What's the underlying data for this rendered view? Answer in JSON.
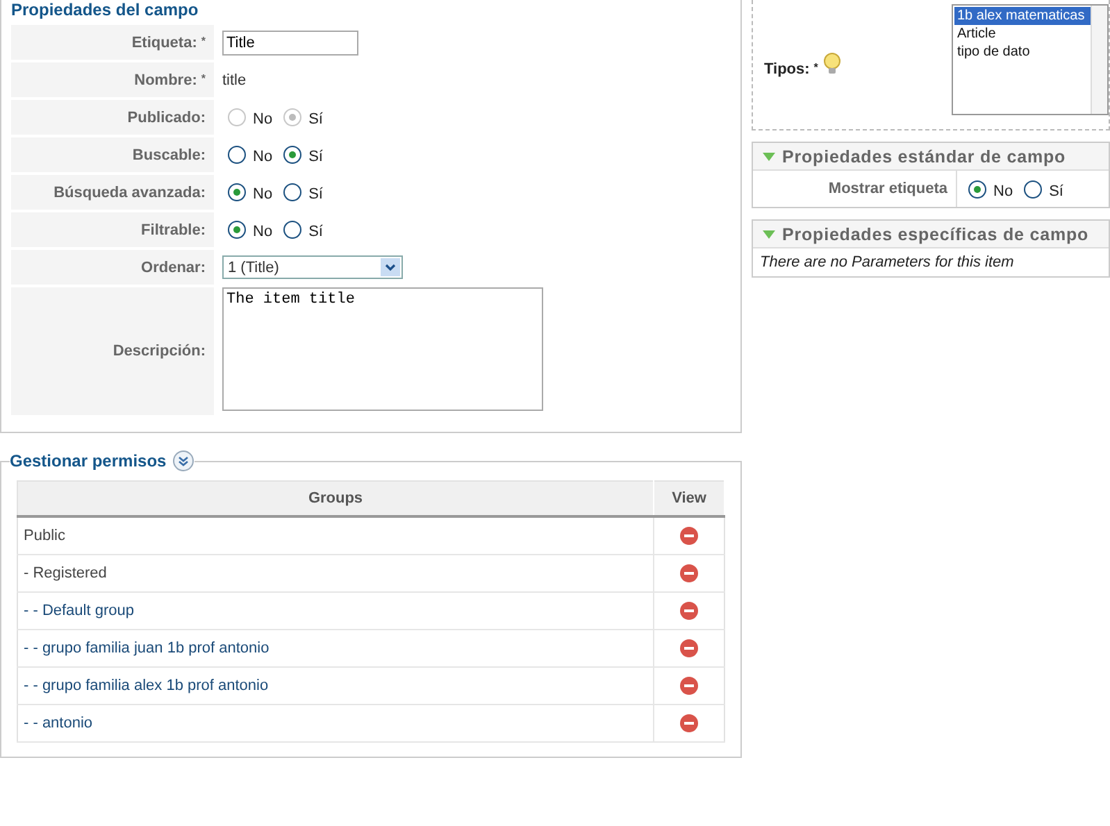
{
  "field_panel": {
    "title": "Propiedades del campo",
    "fields": [
      {
        "kind": "text-input",
        "label": "Etiqueta:",
        "required_mark": "*",
        "value": "Title"
      },
      {
        "kind": "text",
        "label": "Nombre:",
        "required_mark": "*",
        "value": "title"
      },
      {
        "kind": "radio",
        "label": "Publicado:",
        "disabled": true,
        "options": [
          {
            "label": "No",
            "selected": false
          },
          {
            "label": "Sí",
            "selected": true
          }
        ]
      },
      {
        "kind": "radio",
        "label": "Buscable:",
        "disabled": false,
        "options": [
          {
            "label": "No",
            "selected": false
          },
          {
            "label": "Sí",
            "selected": true
          }
        ]
      },
      {
        "kind": "radio",
        "label": "Búsqueda avanzada:",
        "disabled": false,
        "options": [
          {
            "label": "No",
            "selected": true
          },
          {
            "label": "Sí",
            "selected": false
          }
        ]
      },
      {
        "kind": "radio",
        "label": "Filtrable:",
        "disabled": false,
        "options": [
          {
            "label": "No",
            "selected": true
          },
          {
            "label": "Sí",
            "selected": false
          }
        ]
      },
      {
        "kind": "select",
        "label": "Ordenar:",
        "value": "1 (Title)"
      },
      {
        "kind": "textarea",
        "label": "Descripción:",
        "value": "The item title"
      }
    ]
  },
  "permissions": {
    "title": "Gestionar permisos",
    "columns": [
      "Groups",
      "View"
    ],
    "rows": [
      {
        "kind": "plain",
        "group": "Public"
      },
      {
        "kind": "plain",
        "group": "- Registered"
      },
      {
        "kind": "link",
        "group": "- - Default group"
      },
      {
        "kind": "link",
        "group": "- - grupo familia juan 1b prof antonio"
      },
      {
        "kind": "link",
        "group": "- - grupo familia alex 1b prof antonio"
      },
      {
        "kind": "link",
        "group": "- - antonio"
      }
    ]
  },
  "types": {
    "label": "Tipos:",
    "required_mark": "*",
    "items": [
      {
        "label": "1b alex matematicas",
        "selected": true
      },
      {
        "label": "Article",
        "selected": false
      },
      {
        "label": "tipo de dato",
        "selected": false
      }
    ]
  },
  "standard_properties": {
    "title": "Propiedades estándar de campo",
    "fields": [
      {
        "label": "Mostrar etiqueta",
        "options": [
          {
            "label": "No",
            "selected": true
          },
          {
            "label": "Sí",
            "selected": false
          }
        ]
      }
    ]
  },
  "specific_properties": {
    "title": "Propiedades específicas de campo",
    "message": "There are no Parameters for this item"
  }
}
